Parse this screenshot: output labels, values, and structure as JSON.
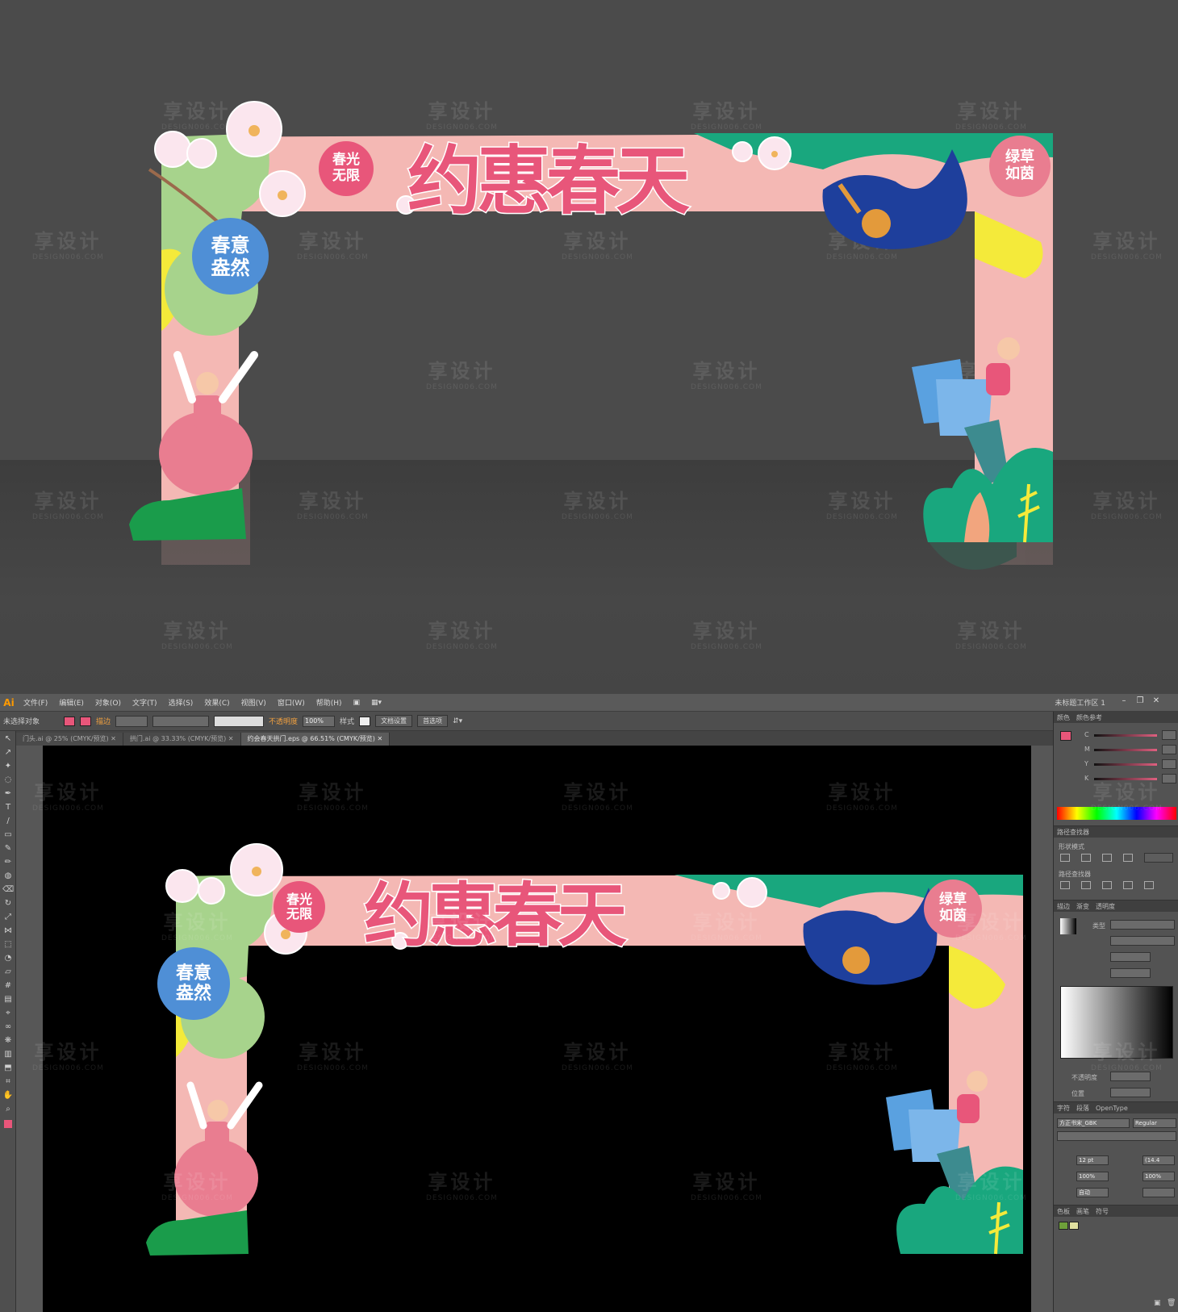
{
  "watermark": {
    "text": "享设计",
    "sub": "DESIGN006.COM"
  },
  "arch": {
    "title": "约惠春天",
    "badge_left_top": "春光无限",
    "badge_left": "春意盎然",
    "badge_right": "绿草如茵",
    "colors": {
      "pink": "#f4b8b4",
      "green": "#19a77e",
      "yellow": "#f4ea3a",
      "blue": "#1e3f9c",
      "light_green": "#a7d38c",
      "title": "#e8567a",
      "badge_blue": "#4f8fd6"
    }
  },
  "app": {
    "logo": "Ai",
    "menu": [
      "文件(F)",
      "编辑(E)",
      "对象(O)",
      "文字(T)",
      "选择(S)",
      "效果(C)",
      "视图(V)",
      "窗口(W)",
      "帮助(H)"
    ],
    "workspace": "未标题工作区 1",
    "control": {
      "selection": "未选择对象",
      "stroke_label": "描边",
      "opacity_label": "不透明度",
      "opacity": "100%",
      "style_label": "样式",
      "doc_setup": "文档设置",
      "prefs": "首选项"
    },
    "tabs": [
      {
        "label": "门头.ai @ 25% (CMYK/预览)",
        "active": false
      },
      {
        "label": "拱门.ai @ 33.33% (CMYK/预览)",
        "active": false
      },
      {
        "label": "约会春天拱门.eps @ 66.51% (CMYK/预览)",
        "active": true
      }
    ],
    "panels": {
      "color_tabs": [
        "颜色",
        "颜色参考"
      ],
      "color_labels": [
        "C",
        "M",
        "Y",
        "K"
      ],
      "pathfinder_title": "路径查找器",
      "shape_mode": "形状模式",
      "pathfinder_label": "路径查找器",
      "stroke_tabs": [
        "描边",
        "渐变",
        "透明度"
      ],
      "gradient_type": "类型",
      "opacity_label": "不透明度",
      "position_label": "位置",
      "char_tabs": [
        "字符",
        "段落",
        "OpenType"
      ],
      "font": "方正书宋_GBK",
      "font_style": "Regular",
      "font_size": "12 pt",
      "leading": "(14.4",
      "scale_h": "100%",
      "scale_v": "100%",
      "tracking": "自动",
      "bottom_tabs": [
        "色板",
        "画笔",
        "符号"
      ]
    }
  }
}
